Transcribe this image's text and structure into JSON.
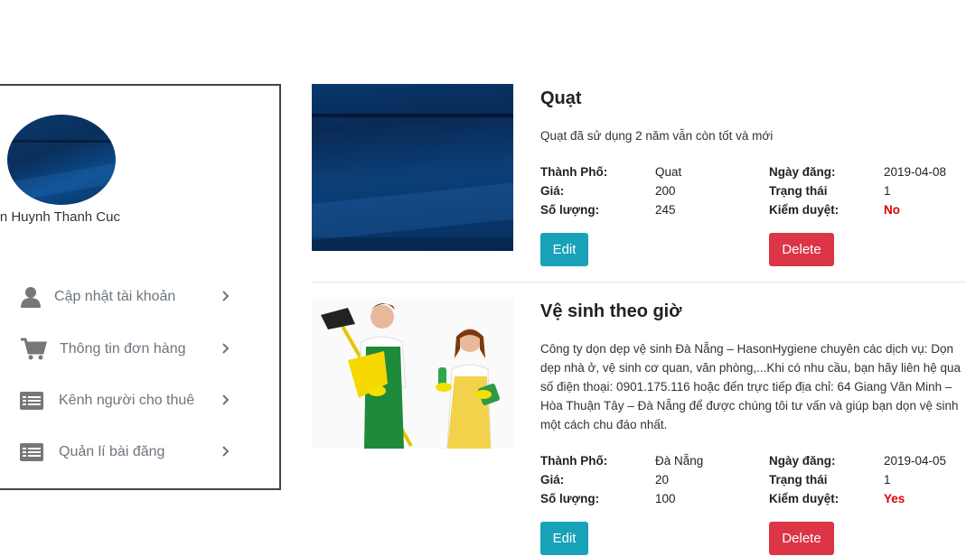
{
  "sidebar": {
    "user_name": "yen Huynh Thanh Cuc",
    "items": [
      {
        "label": "Cập nhật tài khoản",
        "icon": "user-icon"
      },
      {
        "label": "Thông tin đơn hàng",
        "icon": "cart-icon"
      },
      {
        "label": "Kênh người cho thuê",
        "icon": "list-icon"
      },
      {
        "label": "Quản lí bài đăng",
        "icon": "list-icon"
      }
    ]
  },
  "labels": {
    "city": "Thành Phố:",
    "price": "Giá:",
    "quantity": "Số lượng:",
    "post_date": "Ngày đăng:",
    "status": "Trạng thái",
    "approved": "Kiểm duyệt:",
    "edit": "Edit",
    "delete": "Delete"
  },
  "posts": [
    {
      "title": "Quạt",
      "description": "Quạt đã sử dụng 2 năm vẫn còn tốt và mới",
      "city": "Quat",
      "price": "200",
      "quantity": "245",
      "post_date": "2019-04-08",
      "status": "1",
      "approved": "No"
    },
    {
      "title": "Vệ sinh theo giờ",
      "description": "Công ty dọn dẹp vệ sinh Đà Nẵng – HasonHygiene chuyên các dịch vụ: Dọn dẹp nhà ở, vệ sinh cơ quan, văn phòng,...Khi có nhu cầu, bạn hãy liên hệ qua số điện thoại: 0901.175.116 hoặc đến trực tiếp địa chỉ: 64 Giang Văn Minh – Hòa Thuận Tây – Đà Nẵng để được chúng tôi tư vấn và giúp bạn dọn vệ sinh một cách chu đáo nhất.",
      "city": "Đà Nẵng",
      "price": "20",
      "quantity": "100",
      "post_date": "2019-04-05",
      "status": "1",
      "approved": "Yes"
    }
  ],
  "colors": {
    "edit": "#17a2b8",
    "delete": "#dc3545",
    "approved_text": "#e00000"
  }
}
